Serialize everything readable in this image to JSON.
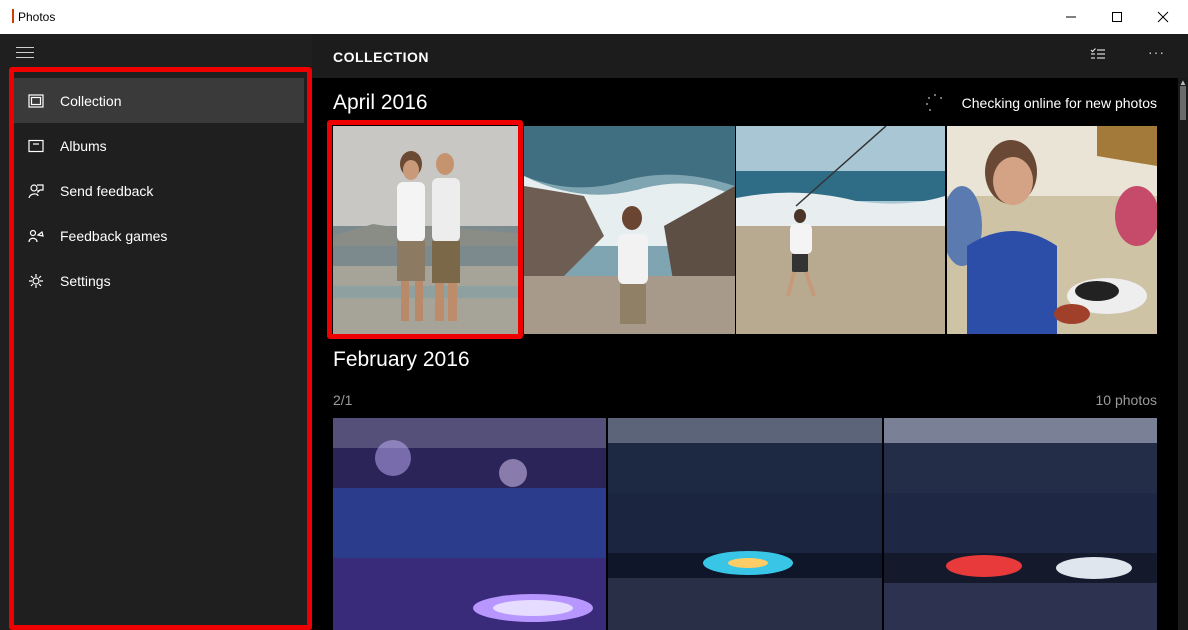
{
  "window": {
    "title": "Photos"
  },
  "header": {
    "title": "COLLECTION"
  },
  "sidebar": {
    "items": [
      {
        "label": "Collection",
        "icon": "collection-icon",
        "active": true
      },
      {
        "label": "Albums",
        "icon": "albums-icon",
        "active": false
      },
      {
        "label": "Send feedback",
        "icon": "feedback-icon",
        "active": false
      },
      {
        "label": "Feedback games",
        "icon": "feedback-games-icon",
        "active": false
      },
      {
        "label": "Settings",
        "icon": "gear-icon",
        "active": false
      }
    ]
  },
  "status": {
    "text": "Checking online for new photos"
  },
  "sections": [
    {
      "title": "April 2016"
    },
    {
      "title": "February 2016",
      "date": "2/1",
      "count": "10 photos"
    }
  ],
  "colors": {
    "highlight": "#ee0000",
    "sidebar_bg": "#1f1f1f",
    "active_item_bg": "#3a3a3a"
  }
}
